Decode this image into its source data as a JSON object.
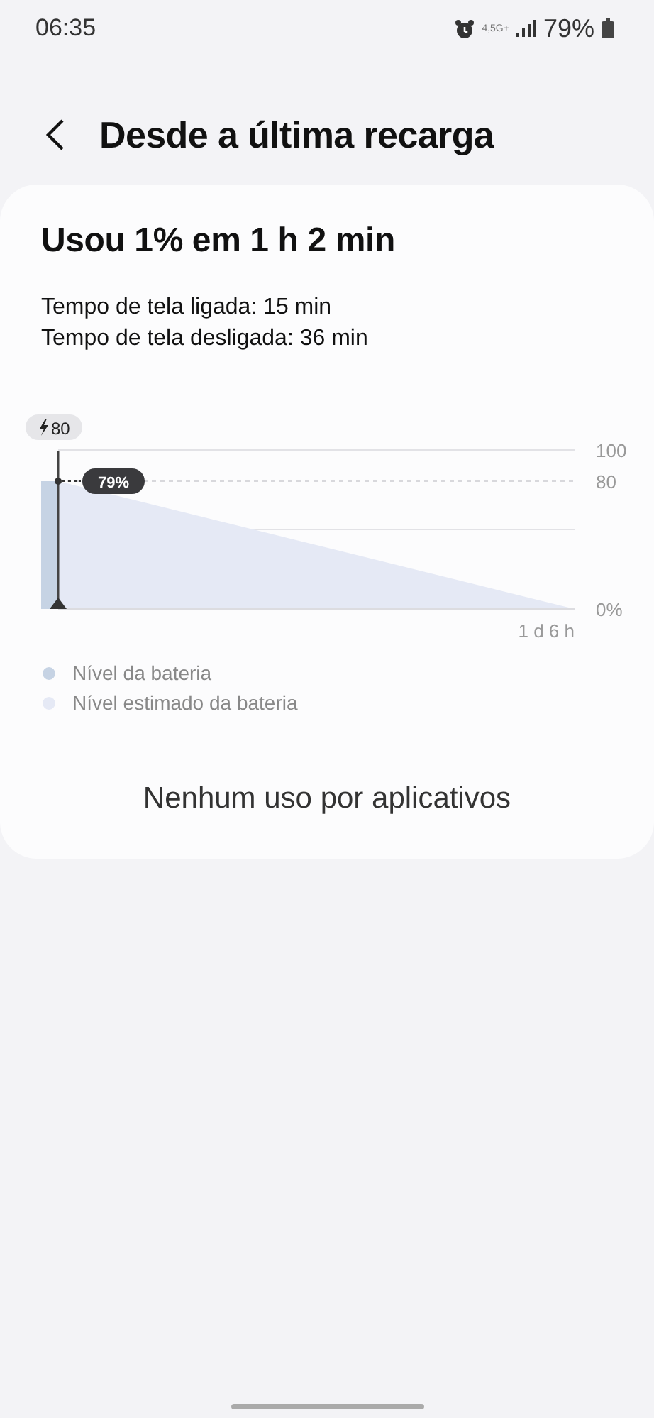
{
  "status_bar": {
    "time": "06:35",
    "network": "4,5G+",
    "battery": "79%"
  },
  "header": {
    "title": "Desde a última recarga"
  },
  "summary": {
    "headline": "Usou 1% em 1 h 2 min",
    "lines": [
      "Tempo de tela ligada: 15 min",
      "Tempo de tela desligada: 36 min"
    ]
  },
  "battery_chart": {
    "kind": "picture",
    "charge_badge": "80",
    "value_badge": "79%",
    "y_labels": [
      "100",
      "80",
      "0%"
    ],
    "x_label": "1 d 6 h"
  },
  "legend": [
    {
      "label": "Nível da bateria",
      "color": "#c6d3e4"
    },
    {
      "label": "Nível estimado da bateria",
      "color": "#e5e9f5"
    }
  ],
  "empty_message": "Nenhum uso por aplicativos"
}
